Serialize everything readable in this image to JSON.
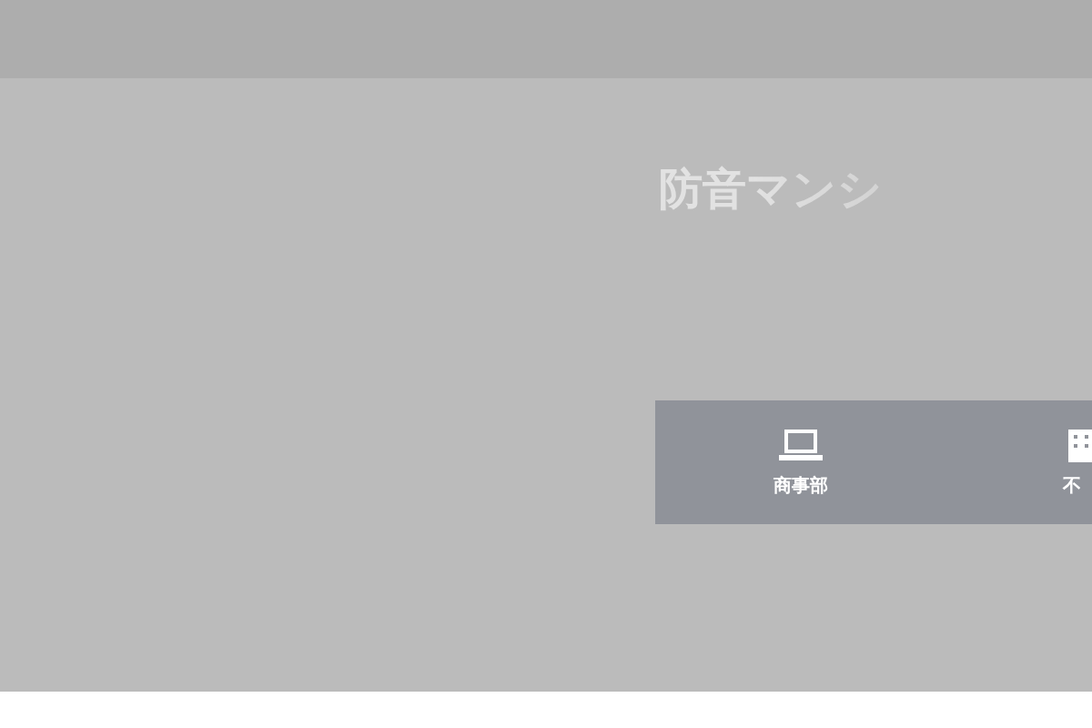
{
  "heading": "防音マンシ",
  "nav": [
    {
      "kind": "laptop",
      "label": "商事部"
    },
    {
      "kind": "building",
      "label": "不"
    }
  ]
}
